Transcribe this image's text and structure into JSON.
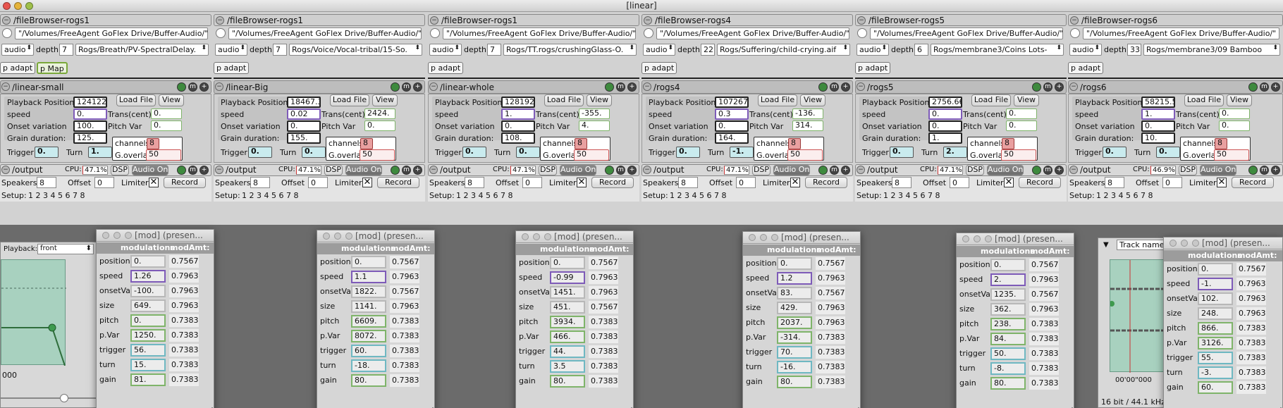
{
  "window_title": "[linear]",
  "colors": {
    "audio_on": "#777777",
    "param_purple": "#7e5bb8",
    "param_green": "#7fb46a",
    "param_teal": "#c9ebee",
    "channels_red": "#e9a0a0",
    "knob_green": "#3e8a3e"
  },
  "columns": [
    {
      "fb_title": "/fileBrowser-rogs1",
      "path": "\"/Volumes/FreeAgent GoFlex Drive/Buffer-Audio/\"",
      "type": "audio",
      "depth_label": "depth",
      "depth": "7",
      "file": "Rogs/Breath/PV-SpectralDelay.",
      "obj1": "p adapt",
      "obj2": "p Map",
      "panel_title": "/linear-small",
      "playback_label": "Playback Position",
      "playback": "124122.",
      "speed_label": "speed",
      "speed": "0.",
      "onset_label": "Onset variation",
      "onset": "100.",
      "grain_label": "Grain duration:",
      "grain": "125.",
      "trans_label": "Trans(cent)",
      "trans": "0.",
      "pitchvar_label": "Pitch Var",
      "pitchvar": "0.",
      "load": "Load File",
      "view": "View",
      "channels_label": "channels",
      "channels": "8",
      "overlap_label": "G.overlap",
      "overlap": "50",
      "trigger_label": "Trigger",
      "trigger": "0.",
      "turn_label": "Turn",
      "turn": "1.",
      "out_title": "/output",
      "cpu_label": "CPU:",
      "cpu": "47.1%",
      "dsp": "DSP",
      "audio_on": "Audio On",
      "speakers_label": "Speakers",
      "speakers": "8",
      "offset_label": "Offset",
      "offset": "0",
      "limiter_label": "Limiter",
      "record": "Record",
      "setup_label": "Setup:",
      "setup": "1 2 3 4 5 6 7 8"
    },
    {
      "fb_title": "/fileBrowser-rogs1",
      "path": "\"/Volumes/FreeAgent GoFlex Drive/Buffer-Audio/\"",
      "type": "audio",
      "depth_label": "depth",
      "depth": "7",
      "file": "Rogs/Voice/Vocal-tribal/15-So.",
      "obj1": "p adapt",
      "panel_title": "/linear-Big",
      "playback_label": "Playback Position",
      "playback": "18467.3",
      "speed_label": "speed",
      "speed": "0.02",
      "onset_label": "Onset variation",
      "onset": "0.",
      "grain_label": "Grain duration:",
      "grain": "155.",
      "trans_label": "Trans(cent)",
      "trans": "2424.",
      "pitchvar_label": "Pitch Var",
      "pitchvar": "0.",
      "load": "Load File",
      "view": "View",
      "channels_label": "channels",
      "channels": "8",
      "overlap_label": "G.overlap",
      "overlap": "50",
      "trigger_label": "Trigger",
      "trigger": "0.",
      "turn_label": "Turn",
      "turn": "0.",
      "out_title": "/output",
      "cpu_label": "CPU:",
      "cpu": "47.1%",
      "dsp": "DSP",
      "audio_on": "Audio On",
      "speakers_label": "Speakers",
      "speakers": "8",
      "offset_label": "Offset",
      "offset": "0",
      "limiter_label": "Limiter",
      "record": "Record",
      "setup_label": "Setup:",
      "setup": "1 2 3 4 5 6 7 8"
    },
    {
      "fb_title": "/fileBrowser-rogs1",
      "path": "\"/Volumes/FreeAgent GoFlex Drive/Buffer-Audio/\"",
      "type": "audio",
      "depth_label": "depth",
      "depth": "7",
      "file": "Rogs/TT.rogs/crushingGlass-O.",
      "obj1": "p adapt",
      "panel_title": "/linear-whole",
      "playback_label": "Playback Position",
      "playback": "128192.",
      "speed_label": "speed",
      "speed": "1.",
      "onset_label": "Onset variation",
      "onset": "0.",
      "grain_label": "Grain duration:",
      "grain": "108.",
      "trans_label": "Trans(cent)",
      "trans": "-355.",
      "pitchvar_label": "Pitch Var",
      "pitchvar": "4.",
      "load": "Load File",
      "view": "View",
      "channels_label": "channels",
      "channels": "8",
      "overlap_label": "G.overlap",
      "overlap": "50",
      "trigger_label": "Trigger",
      "trigger": "0.",
      "turn_label": "Turn",
      "turn": "0.",
      "out_title": "/output",
      "cpu_label": "CPU:",
      "cpu": "47.1%",
      "dsp": "DSP",
      "audio_on": "Audio On",
      "speakers_label": "Speakers",
      "speakers": "8",
      "offset_label": "Offset",
      "offset": "0",
      "limiter_label": "Limiter",
      "record": "Record",
      "setup_label": "Setup:",
      "setup": "1 2 3 4 5 6 7 8"
    },
    {
      "fb_title": "/fileBrowser-rogs4",
      "path": "\"/Volumes/FreeAgent GoFlex Drive/Buffer-Audio/\"",
      "type": "audio",
      "depth_label": "depth",
      "depth": "22",
      "file": "Rogs/Suffering/child-crying.aif",
      "obj1": "p adapt",
      "panel_title": "/rogs4",
      "playback_label": "Playback Position",
      "playback": "107267.",
      "speed_label": "speed",
      "speed": "0.3",
      "onset_label": "Onset variation",
      "onset": "0.",
      "grain_label": "Grain duration:",
      "grain": "164.",
      "trans_label": "Trans(cent)",
      "trans": "-136.",
      "pitchvar_label": "Pitch Var",
      "pitchvar": "314.",
      "load": "Load File",
      "view": "View",
      "channels_label": "channels",
      "channels": "8",
      "overlap_label": "G.overlap",
      "overlap": "50",
      "trigger_label": "Trigger",
      "trigger": "0.",
      "turn_label": "Turn",
      "turn": "-1.",
      "out_title": "/output",
      "cpu_label": "CPU:",
      "cpu": "47.1%",
      "dsp": "DSP",
      "audio_on": "Audio On",
      "speakers_label": "Speakers",
      "speakers": "8",
      "offset_label": "Offset",
      "offset": "0",
      "limiter_label": "Limiter",
      "record": "Record",
      "setup_label": "Setup:",
      "setup": "1 2 3 4 5 6 7 8"
    },
    {
      "fb_title": "/fileBrowser-rogs5",
      "path": "\"/Volumes/FreeAgent GoFlex Drive/Buffer-Audio/\"",
      "type": "audio",
      "depth_label": "depth",
      "depth": "6",
      "file": "Rogs/membrane3/Coins Lots-",
      "obj1": "p adapt",
      "panel_title": "/rogs5",
      "playback_label": "Playback Position",
      "playback": "2756.66",
      "speed_label": "speed",
      "speed": "0.",
      "onset_label": "Onset variation",
      "onset": "0.",
      "grain_label": "Grain duration:",
      "grain": "1.",
      "trans_label": "Trans(cent)",
      "trans": "0.",
      "pitchvar_label": "Pitch Var",
      "pitchvar": "0.",
      "load": "Load File",
      "view": "View",
      "channels_label": "channels",
      "channels": "8",
      "overlap_label": "G.overlap",
      "overlap": "50",
      "trigger_label": "Trigger",
      "trigger": "0.",
      "turn_label": "Turn",
      "turn": "2.",
      "out_title": "/output",
      "cpu_label": "CPU:",
      "cpu": "47.1%",
      "dsp": "DSP",
      "audio_on": "Audio On",
      "speakers_label": "Speakers",
      "speakers": "8",
      "offset_label": "Offset",
      "offset": "0",
      "limiter_label": "Limiter",
      "record": "Record",
      "setup_label": "Setup:",
      "setup": "1 2 3 4 5 6 7 8"
    },
    {
      "fb_title": "/fileBrowser-rogs6",
      "path": "\"/Volumes/FreeAgent GoFlex Drive/Buffer-Audio/\"",
      "type": "audio",
      "depth_label": "depth",
      "depth": "33",
      "file": "Rogs/membrane3/09 Bamboo",
      "obj1": "p adapt",
      "panel_title": "/rogs6",
      "playback_label": "Playback Position",
      "playback": "58215.5",
      "speed_label": "speed",
      "speed": "1.",
      "onset_label": "Onset variation",
      "onset": "0.",
      "grain_label": "Grain duration:",
      "grain": "10.",
      "trans_label": "Trans(cent)",
      "trans": "0.",
      "pitchvar_label": "Pitch Var",
      "pitchvar": "0.",
      "load": "Load File",
      "view": "View",
      "channels_label": "channels",
      "channels": "8",
      "overlap_label": "G.overlap",
      "overlap": "50",
      "trigger_label": "Trigger",
      "trigger": "0.",
      "turn_label": "Turn",
      "turn": "0.",
      "out_title": "/output",
      "cpu_label": "CPU:",
      "cpu": "46.9%",
      "dsp": "DSP",
      "audio_on": "Audio On",
      "speakers_label": "Speakers",
      "speakers": "8",
      "offset_label": "Offset",
      "offset": "0",
      "limiter_label": "Limiter",
      "record": "Record",
      "setup_label": "Setup:",
      "setup": "1 2 3 4 5 6 7 8"
    }
  ],
  "background": {
    "playback_label": "Playback:",
    "playback_value": "front",
    "left_time": "000",
    "track_name": "Track name",
    "right_time": "00'00\"000",
    "format": "16 bit / 44.1 kHz"
  },
  "mod_windows": [
    {
      "title": "[mod] (presen...",
      "head_name": "modulations",
      "head_amt": "modAmt:",
      "rows": [
        {
          "label": "position",
          "value": "0.",
          "amt": "0.7567"
        },
        {
          "label": "speed",
          "value": "1.26",
          "amt": "0.7963"
        },
        {
          "label": "onsetVar",
          "value": "-100.",
          "amt": "0.7963"
        },
        {
          "label": "size",
          "value": "649.",
          "amt": "0.7963"
        },
        {
          "label": "pitch",
          "value": "0.",
          "amt": "0.7383"
        },
        {
          "label": "p.Var",
          "value": "1250.",
          "amt": "0.7383"
        },
        {
          "label": "trigger",
          "value": "56.",
          "amt": "0.7383"
        },
        {
          "label": "turn",
          "value": "15.",
          "amt": "0.7383"
        },
        {
          "label": "gain",
          "value": "81.",
          "amt": "0.7383"
        }
      ]
    },
    {
      "title": "[mod] (presen...",
      "head_name": "modulations",
      "head_amt": "modAmt:",
      "rows": [
        {
          "label": "position",
          "value": "0.",
          "amt": "0.7567"
        },
        {
          "label": "speed",
          "value": "1.1",
          "amt": "0.7963"
        },
        {
          "label": "onsetVar",
          "value": "1822.",
          "amt": "0.7567"
        },
        {
          "label": "size",
          "value": "1141.",
          "amt": "0.7963"
        },
        {
          "label": "pitch",
          "value": "6609.",
          "amt": "0.7383"
        },
        {
          "label": "p.Var",
          "value": "8072.",
          "amt": "0.7383"
        },
        {
          "label": "trigger",
          "value": "60.",
          "amt": "0.7383"
        },
        {
          "label": "turn",
          "value": "-18.",
          "amt": "0.7383"
        },
        {
          "label": "gain",
          "value": "80.",
          "amt": "0.7383"
        }
      ]
    },
    {
      "title": "[mod] (presen...",
      "head_name": "modulations",
      "head_amt": "modAmt:",
      "rows": [
        {
          "label": "position",
          "value": "0.",
          "amt": "0.7567"
        },
        {
          "label": "speed",
          "value": "-0.99",
          "amt": "0.7963"
        },
        {
          "label": "onsetVar",
          "value": "1451.",
          "amt": "0.7963"
        },
        {
          "label": "size",
          "value": "451.",
          "amt": "0.7567"
        },
        {
          "label": "pitch",
          "value": "3934.",
          "amt": "0.7383"
        },
        {
          "label": "p.Var",
          "value": "466.",
          "amt": "0.7383"
        },
        {
          "label": "trigger",
          "value": "44.",
          "amt": "0.7383"
        },
        {
          "label": "turn",
          "value": "3.5",
          "amt": "0.7383"
        },
        {
          "label": "gain",
          "value": "80.",
          "amt": "0.7383"
        }
      ]
    },
    {
      "title": "[mod] (presen...",
      "head_name": "modulations",
      "head_amt": "modAmt:",
      "rows": [
        {
          "label": "position",
          "value": "0.",
          "amt": "0.7567"
        },
        {
          "label": "speed",
          "value": "1.2",
          "amt": "0.7963"
        },
        {
          "label": "onsetVar",
          "value": "83.",
          "amt": "0.7567"
        },
        {
          "label": "size",
          "value": "429.",
          "amt": "0.7963"
        },
        {
          "label": "pitch",
          "value": "2037.",
          "amt": "0.7963"
        },
        {
          "label": "p.Var",
          "value": "-314.",
          "amt": "0.7383"
        },
        {
          "label": "trigger",
          "value": "70.",
          "amt": "0.7383"
        },
        {
          "label": "turn",
          "value": "-16.",
          "amt": "0.7383"
        },
        {
          "label": "gain",
          "value": "80.",
          "amt": "0.7383"
        }
      ]
    },
    {
      "title": "[mod] (presen...",
      "head_name": "modulations",
      "head_amt": "modAmt:",
      "rows": [
        {
          "label": "position",
          "value": "0.",
          "amt": "0.7567"
        },
        {
          "label": "speed",
          "value": "2.",
          "amt": "0.7963"
        },
        {
          "label": "onsetVar",
          "value": "1235.",
          "amt": "0.7567"
        },
        {
          "label": "size",
          "value": "362.",
          "amt": "0.7963"
        },
        {
          "label": "pitch",
          "value": "238.",
          "amt": "0.7383"
        },
        {
          "label": "p.Var",
          "value": "84.",
          "amt": "0.7383"
        },
        {
          "label": "trigger",
          "value": "50.",
          "amt": "0.7383"
        },
        {
          "label": "turn",
          "value": "-8.",
          "amt": "0.7383"
        },
        {
          "label": "gain",
          "value": "80.",
          "amt": "0.7383"
        }
      ]
    },
    {
      "title": "[mod] (presen...",
      "head_name": "modulations",
      "head_amt": "modAmt:",
      "rows": [
        {
          "label": "position",
          "value": "0.",
          "amt": "0.7567"
        },
        {
          "label": "speed",
          "value": "-1.",
          "amt": "0.7963"
        },
        {
          "label": "onsetVar",
          "value": "102.",
          "amt": "0.7963"
        },
        {
          "label": "size",
          "value": "248.",
          "amt": "0.7963"
        },
        {
          "label": "pitch",
          "value": "866.",
          "amt": "0.7383"
        },
        {
          "label": "p.Var",
          "value": "3126.",
          "amt": "0.7383"
        },
        {
          "label": "trigger",
          "value": "55.",
          "amt": "0.7383"
        },
        {
          "label": "turn",
          "value": "-3.",
          "amt": "0.7383"
        },
        {
          "label": "gain",
          "value": "60.",
          "amt": "0.7383"
        }
      ]
    }
  ]
}
